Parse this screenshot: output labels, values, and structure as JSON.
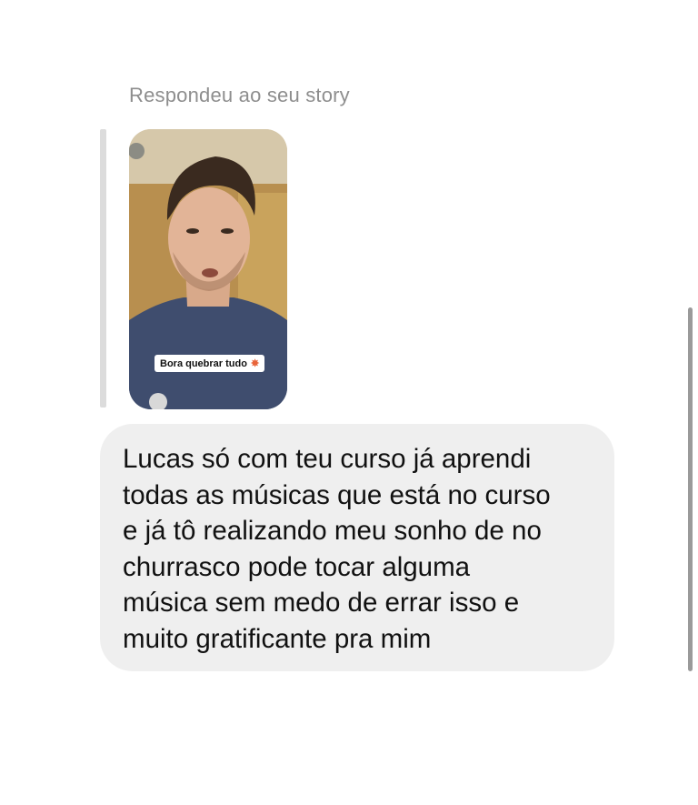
{
  "reply_caption": "Respondeu ao seu story",
  "story": {
    "sticker_text": "Bora quebrar tudo",
    "sticker_icon": "burst-icon"
  },
  "message": {
    "text": "Lucas só com teu curso já aprendi\ntodas as músicas que está no curso\ne já tô realizando meu sonho de no\nchurrasco pode tocar alguma\nmúsica sem medo de errar isso e\nmuito gratificante pra mim"
  },
  "colors": {
    "caption": "#8e8e8e",
    "bubble": "#efefef",
    "text": "#111111"
  }
}
